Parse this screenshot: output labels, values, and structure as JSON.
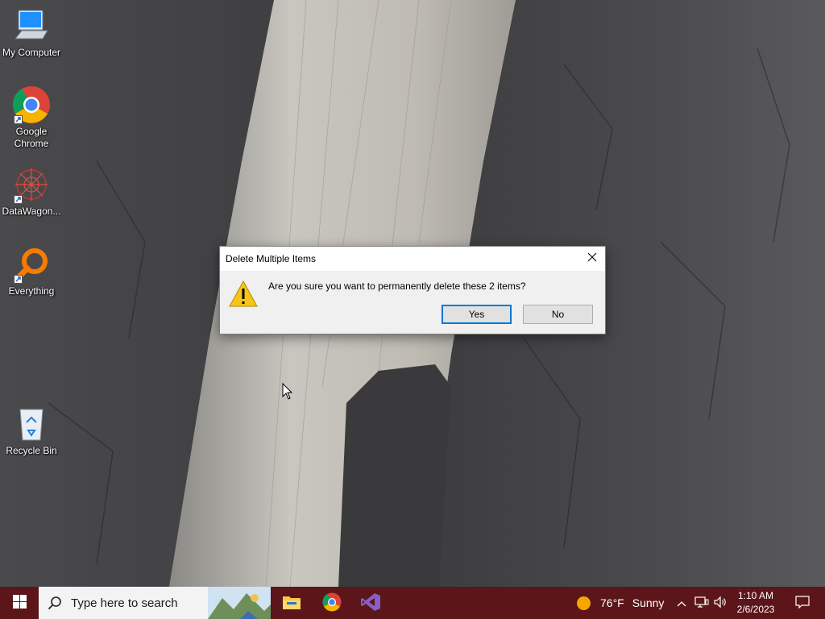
{
  "desktop": {
    "icons": [
      {
        "label": "My Computer",
        "icon": "computer-icon"
      },
      {
        "label": "Google Chrome",
        "icon": "chrome-icon"
      },
      {
        "label": "DataWagon...",
        "icon": "datawagon-icon"
      },
      {
        "label": "Everything",
        "icon": "everything-icon"
      },
      {
        "label": "Recycle Bin",
        "icon": "recycle-bin-icon"
      }
    ]
  },
  "dialog": {
    "title": "Delete Multiple Items",
    "message": "Are you sure you want to permanently delete these 2 items?",
    "yes_label": "Yes",
    "no_label": "No",
    "close_icon": "close-icon",
    "warning_icon": "warning-icon"
  },
  "taskbar": {
    "search_placeholder": "Type here to search",
    "apps": [
      "file-explorer-icon",
      "chrome-icon",
      "visual-studio-icon"
    ],
    "weather": {
      "temp": "76°F",
      "condition": "Sunny"
    },
    "clock": {
      "time": "1:10 AM",
      "date": "2/6/2023"
    },
    "colors": {
      "taskbar": "#5c1518",
      "accent": "#0078d7"
    }
  }
}
